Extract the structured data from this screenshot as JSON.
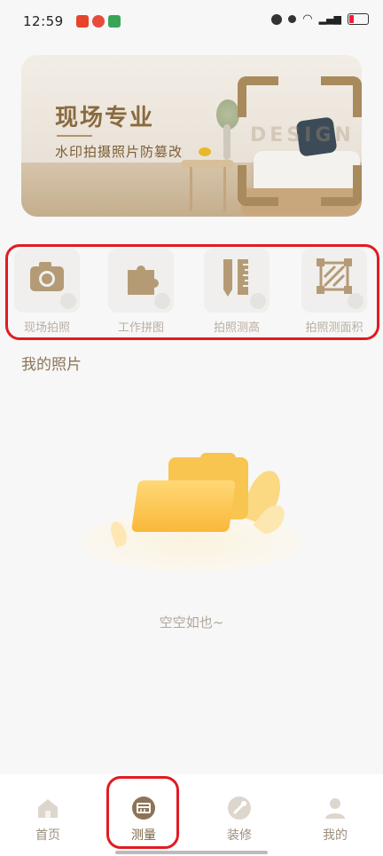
{
  "status_bar": {
    "time": "12:59",
    "battery_text": "1"
  },
  "banner": {
    "title": "现场专业",
    "subtitle": "水印拍摄照片防篡改",
    "overlay_word": "DESIGN"
  },
  "tools": [
    {
      "label": "现场拍照",
      "icon": "camera-icon"
    },
    {
      "label": "工作拼图",
      "icon": "puzzle-icon"
    },
    {
      "label": "拍照测高",
      "icon": "ruler-pencil-icon"
    },
    {
      "label": "拍照测面积",
      "icon": "area-measure-icon"
    }
  ],
  "section": {
    "title": "我的照片"
  },
  "empty_state": {
    "text": "空空如也~"
  },
  "bottom_nav": {
    "items": [
      {
        "label": "首页",
        "icon": "home-icon",
        "active": false
      },
      {
        "label": "测量",
        "icon": "measure-icon",
        "active": true
      },
      {
        "label": "装修",
        "icon": "decorate-icon",
        "active": false
      },
      {
        "label": "我的",
        "icon": "profile-icon",
        "active": false
      }
    ]
  },
  "colors": {
    "accent": "#8b7458",
    "tool_icon": "#b59b75",
    "highlight_border": "#e11b22"
  }
}
